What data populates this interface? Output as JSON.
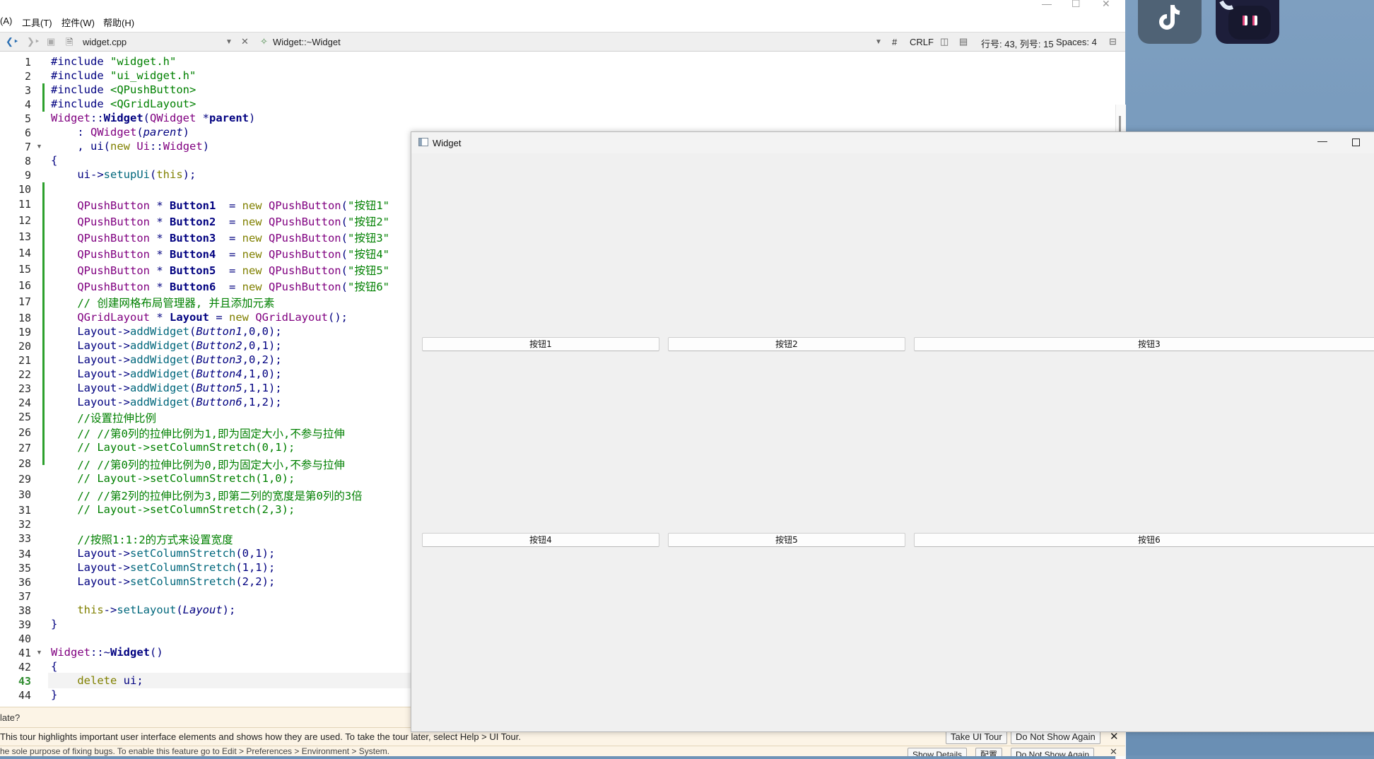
{
  "menubar": {
    "items": [
      "(A)",
      "工具(T)",
      "控件(W)",
      "帮助(H)"
    ]
  },
  "toolbar": {
    "file_name": "widget.cpp",
    "symbol": "Widget::~Widget",
    "hash": "#",
    "line_ending": "CRLF",
    "position": "行号: 43, 列号: 15",
    "indent": "Spaces: 4"
  },
  "editor": {
    "current_line": 43,
    "line_numbers": [
      "1",
      "2",
      "3",
      "4",
      "5",
      "6",
      "7",
      "8",
      "9",
      "10",
      "11",
      "12",
      "13",
      "14",
      "15",
      "16",
      "17",
      "18",
      "19",
      "20",
      "21",
      "22",
      "23",
      "24",
      "25",
      "26",
      "27",
      "28",
      "29",
      "30",
      "31",
      "32",
      "33",
      "34",
      "35",
      "36",
      "37",
      "38",
      "39",
      "40",
      "41",
      "42",
      "43",
      "44"
    ],
    "lines": [
      "#include \"widget.h\"",
      "#include \"ui_widget.h\"",
      "#include <QPushButton>",
      "#include <QGridLayout>",
      "Widget::Widget(QWidget *parent)",
      "    : QWidget(parent)",
      "    , ui(new Ui::Widget)",
      "{",
      "    ui->setupUi(this);",
      "",
      "    QPushButton * Button1  = new QPushButton(\"按钮1\"",
      "    QPushButton * Button2  = new QPushButton(\"按钮2\"",
      "    QPushButton * Button3  = new QPushButton(\"按钮3\"",
      "    QPushButton * Button4  = new QPushButton(\"按钮4\"",
      "    QPushButton * Button5  = new QPushButton(\"按钮5\"",
      "    QPushButton * Button6  = new QPushButton(\"按钮6\"",
      "    // 创建网格布局管理器, 并且添加元素",
      "    QGridLayout * Layout = new QGridLayout();",
      "    Layout->addWidget(Button1,0,0);",
      "    Layout->addWidget(Button2,0,1);",
      "    Layout->addWidget(Button3,0,2);",
      "    Layout->addWidget(Button4,1,0);",
      "    Layout->addWidget(Button5,1,1);",
      "    Layout->addWidget(Button6,1,2);",
      "    //设置拉伸比例",
      "    // //第0列的拉伸比例为1,即为固定大小,不参与拉伸",
      "    // Layout->setColumnStretch(0,1);",
      "    // //第0列的拉伸比例为0,即为固定大小,不参与拉伸",
      "    // Layout->setColumnStretch(1,0);",
      "    // //第2列的拉伸比例为3,即第二列的宽度是第0列的3倍",
      "    // Layout->setColumnStretch(2,3);",
      "",
      "    //按照1:1:2的方式来设置宽度",
      "    Layout->setColumnStretch(0,1);",
      "    Layout->setColumnStretch(1,1);",
      "    Layout->setColumnStretch(2,2);",
      "",
      "    this->setLayout(Layout);",
      "}",
      "",
      "Widget::~Widget()",
      "{",
      "    delete ui;",
      "}"
    ]
  },
  "widget_window": {
    "title": "Widget",
    "buttons": [
      "按钮1",
      "按钮2",
      "按钮3",
      "按钮4",
      "按钮5",
      "按钮6"
    ]
  },
  "tour": {
    "prompt_fragment": "late?",
    "message": "This tour highlights important user interface elements and shows how they are used. To take the tour later, select Help > UI Tour.",
    "take_tour": "Take UI Tour",
    "dont_show": "Do Not Show Again",
    "bug_message": "he sole purpose of fixing bugs. To enable this feature go to Edit > Preferences > Environment > System.",
    "show_details": "Show Details",
    "configure": "配置",
    "dont_show_2": "Do Not Show Again"
  },
  "colors": {
    "keyword": "#808000",
    "type": "#800080",
    "string": "#008000",
    "comment": "#008000",
    "function": "#00677c",
    "desktop": "#7397bb"
  }
}
